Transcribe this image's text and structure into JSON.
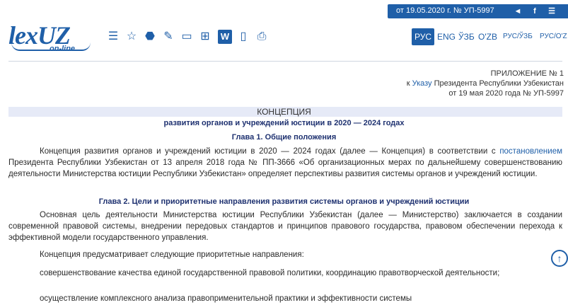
{
  "header": {
    "doc_ref": "от 19.05.2020 г. № УП-5997",
    "share_icons": [
      "share-icon",
      "facebook-icon",
      "menu-icon"
    ]
  },
  "logo": {
    "text": "lexUZ",
    "subtitle": "on-line"
  },
  "toolbar": {
    "icons": [
      "list-icon",
      "star-icon",
      "tag-icon",
      "edit-icon",
      "calendar-icon",
      "compare-icon",
      "word-icon",
      "pdf-icon",
      "print-icon"
    ],
    "word_label": "W"
  },
  "languages": [
    {
      "label": "РУС",
      "active": true
    },
    {
      "label": "ENG",
      "active": false
    },
    {
      "label": "ЎЗБ",
      "active": false
    },
    {
      "label": "O'ZB",
      "active": false
    },
    {
      "label": "РУС/ЎЗБ",
      "active": false
    },
    {
      "label": "РУС/O'Z",
      "active": false
    }
  ],
  "appendix": {
    "line1": "ПРИЛОЖЕНИЕ № 1",
    "line2_prefix": "к ",
    "line2_link": "Указу",
    "line2_suffix": " Президента Республики Узбекистан",
    "line3": "от 19 мая 2020 года № УП-5997"
  },
  "document": {
    "title": "КОНЦЕПЦИЯ",
    "subtitle": "развития органов и учреждений юстиции в 2020 — 2024 годах",
    "chapter1": "Глава 1. Общие положения",
    "p1_a": "Концепция развития органов и учреждений юстиции в 2020 — 2024 годах (далее — Концепция) в соответствии с ",
    "p1_link": "постановлением",
    "p1_b": " Президента Республики Узбекистан от 13 апреля 2018 года № ПП-3666 «Об организационных мерах по дальнейшему совершенствованию деятельности Министерства юстиции Республики Узбекистан» определяет перспективы развития системы органов и учреждений юстиции.",
    "chapter2": "Глава 2. Цели и приоритетные направления развития системы органов и учреждений юстиции",
    "p2": "Основная цель деятельности Министерства юстиции Республики Узбекистан (далее — Министерство) заключается в создании современной правовой системы, внедрении передовых стандартов и принципов правового государства, правовом обеспечении перехода к эффективной модели государственного управления.",
    "p3": "Концепция предусматривает следующие приоритетные направления:",
    "p4": "совершенствование качества единой государственной правовой политики, координацию правотворческой деятельности;",
    "p5": "осуществление комплексного анализа правоприменительной практики и эффективности системы"
  }
}
